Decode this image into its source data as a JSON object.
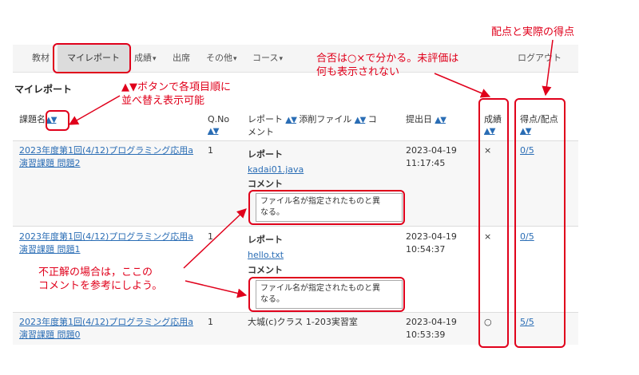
{
  "nav": {
    "items": [
      "教材",
      "マイレポート",
      "成績",
      "出席",
      "その他",
      "コース",
      "ログアウト"
    ],
    "caret": "▾"
  },
  "page_title": "マイレポート",
  "table": {
    "headers": {
      "title": "課題名",
      "qno": "Q.No",
      "report_a": "レポート",
      "report_b": "添削ファイル",
      "report_c": "コ",
      "report_d": "メント",
      "date": "提出日",
      "grade": "成績",
      "score": "得点/配点"
    },
    "sort_label": "▲▼",
    "rows": [
      {
        "title_l1": "2023年度第1回(4/12)プログラミング応用a",
        "title_l2": "演習課題 問題2",
        "qno": "1",
        "report_label": "レポート",
        "file": "kadai01.java",
        "comment_label": "コメント",
        "comment_l1": "ファイル名が指定されたものと異",
        "comment_l2": "なる。",
        "date_l1": "2023-04-19",
        "date_l2": "11:17:45",
        "grade": "×",
        "score": "0/5"
      },
      {
        "title_l1": "2023年度第1回(4/12)プログラミング応用a",
        "title_l2": "演習課題 問題1",
        "qno": "1",
        "report_label": "レポート",
        "file": "hello.txt",
        "comment_label": "コメント",
        "comment_l1": "ファイル名が指定されたものと異",
        "comment_l2": "なる。",
        "date_l1": "2023-04-19",
        "date_l2": "10:54:37",
        "grade": "×",
        "score": "0/5"
      },
      {
        "title_l1": "2023年度第1回(4/12)プログラミング応用a",
        "title_l2": "演習課題 問題0",
        "qno": "1",
        "location": "大城(c)クラス 1-203実習室",
        "date_l1": "2023-04-19",
        "date_l2": "10:53:39",
        "grade": "○",
        "score": "5/5"
      }
    ]
  },
  "annotations": {
    "score": "配点と実際の得点",
    "grade_l1": "合否は○×で分かる。未評価は",
    "grade_l2": "何も表示されない",
    "sort_l1": "▲▼ボタンで各項目順に",
    "sort_l2": "並べ替え表示可能",
    "comment_l1": "不正解の場合は，ここの",
    "comment_l2": "コメントを参考にしよう。"
  },
  "colors": {
    "annotation": "#e0001b",
    "link": "#2a6db5"
  }
}
